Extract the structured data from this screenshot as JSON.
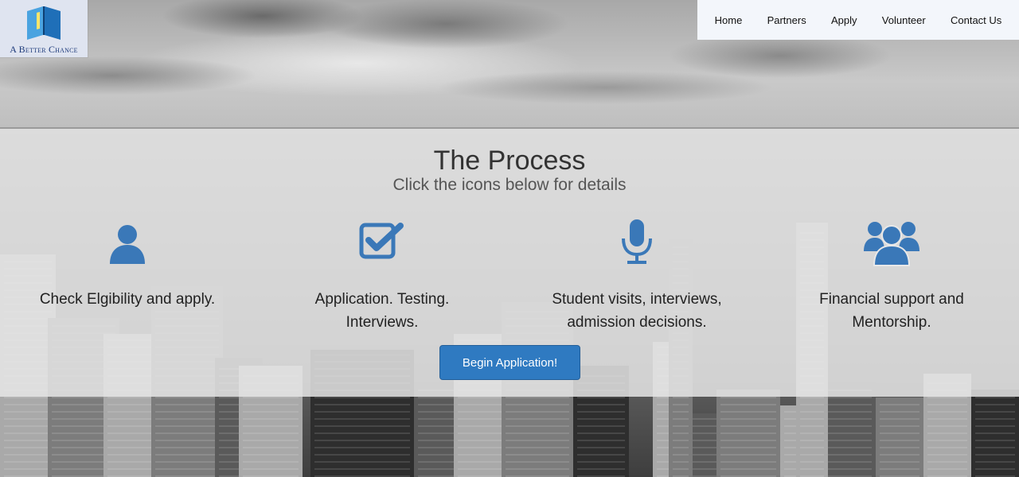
{
  "brand": {
    "logo_text": "A Better Chance"
  },
  "nav": {
    "items": [
      {
        "label": "Home"
      },
      {
        "label": "Partners"
      },
      {
        "label": "Apply"
      },
      {
        "label": "Volunteer"
      },
      {
        "label": "Contact Us"
      }
    ]
  },
  "process": {
    "title": "The Process",
    "subtitle": "Click the icons below for details",
    "steps": [
      {
        "icon": "user-icon",
        "line1": "Check Elgibility and apply.",
        "line2": ""
      },
      {
        "icon": "checkbox-icon",
        "line1": "Application. Testing.",
        "line2": "Interviews."
      },
      {
        "icon": "microphone-icon",
        "line1": "Student visits, interviews,",
        "line2": "admission decisions."
      },
      {
        "icon": "group-icon",
        "line1": "Financial support and",
        "line2": "Mentorship."
      }
    ],
    "cta_label": "Begin Application!"
  },
  "colors": {
    "accent": "#2f7ac1",
    "icon": "#3a78b8",
    "nav_bg": "#f3f6fb"
  }
}
